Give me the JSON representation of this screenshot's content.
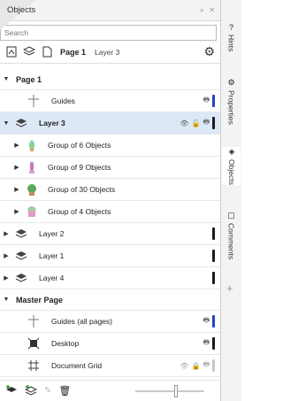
{
  "panel": {
    "title": "Objects"
  },
  "search": {
    "placeholder": "Search"
  },
  "toolbar": {
    "page": "Page 1",
    "layer": "Layer 3"
  },
  "tree": {
    "page_section": "Page 1",
    "guides": "Guides",
    "layer3": "Layer 3",
    "groups": [
      "Group of 6 Objects",
      "Group of 9 Objects",
      "Group of 30 Objects",
      "Group of 4 Objects"
    ],
    "layer2": "Layer 2",
    "layer1": "Layer 1",
    "layer4": "Layer 4",
    "master_section": "Master Page",
    "guides_all": "Guides (all pages)",
    "desktop": "Desktop",
    "grid": "Document Grid"
  },
  "sidebar": {
    "tabs": [
      "Hints",
      "Properties",
      "Objects",
      "Comments"
    ]
  },
  "colors": {
    "layer_bar": "#1a1a1a",
    "guides_bar": "#2a3fc8",
    "selected_bg": "#dde8f6"
  }
}
